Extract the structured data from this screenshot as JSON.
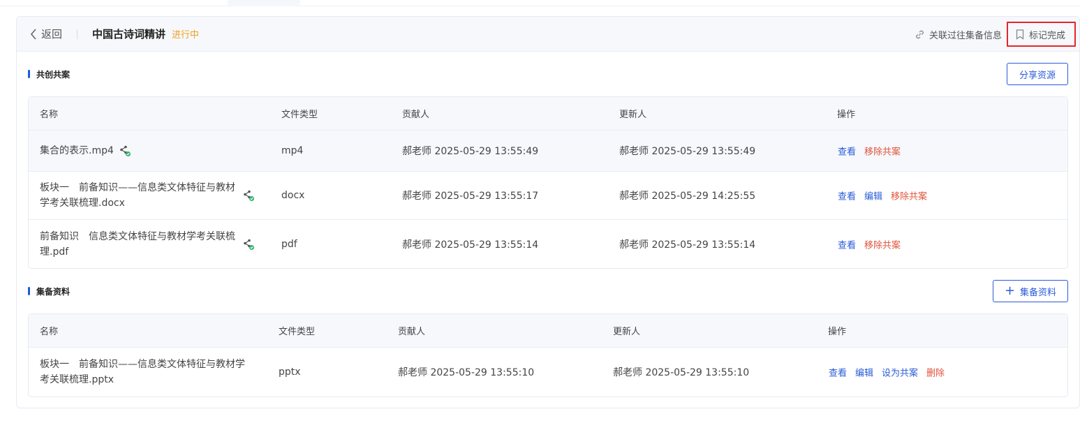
{
  "header": {
    "back_label": "返回",
    "title": "中国古诗词精讲",
    "status": "进行中",
    "link_label": "关联过往集备信息",
    "mark_done_label": "标记完成"
  },
  "section1": {
    "title": "共创共案",
    "button_label": "分享资源",
    "columns": [
      "名称",
      "文件类型",
      "贡献人",
      "更新人",
      "操作"
    ],
    "rows": [
      {
        "name": "集合的表示.mp4",
        "type": "mp4",
        "contributor": "郝老师 2025-05-29 13:55:49",
        "updater": "郝老师 2025-05-29 13:55:49",
        "ops": [
          "查看",
          "移除共案"
        ]
      },
      {
        "name": "板块一　前备知识——信息类文体特征与教材学考关联梳理.docx",
        "type": "docx",
        "contributor": "郝老师 2025-05-29 13:55:17",
        "updater": "郝老师 2025-05-29 14:25:55",
        "ops": [
          "查看",
          "编辑",
          "移除共案"
        ]
      },
      {
        "name": "前备知识　信息类文体特征与教材学考关联梳理.pdf",
        "type": "pdf",
        "contributor": "郝老师 2025-05-29 13:55:14",
        "updater": "郝老师 2025-05-29 13:55:14",
        "ops": [
          "查看",
          "移除共案"
        ]
      }
    ]
  },
  "section2": {
    "title": "集备资料",
    "button_label": "集备资料",
    "columns": [
      "名称",
      "文件类型",
      "贡献人",
      "更新人",
      "操作"
    ],
    "rows": [
      {
        "name": "板块一　前备知识——信息类文体特征与教材学考关联梳理.pptx",
        "type": "pptx",
        "contributor": "郝老师 2025-05-29 13:55:10",
        "updater": "郝老师 2025-05-29 13:55:10",
        "ops": [
          "查看",
          "编辑",
          "设为共案",
          "删除"
        ]
      }
    ]
  },
  "icons": {
    "back": "chevron-left-icon",
    "link": "link-icon",
    "bookmark": "bookmark-icon",
    "share": "share-icon",
    "plus": "plus-icon"
  },
  "colors": {
    "accent": "#2a5bd7",
    "status": "#f0a020",
    "danger": "#e0523a",
    "highlight_border": "#e6252a"
  }
}
